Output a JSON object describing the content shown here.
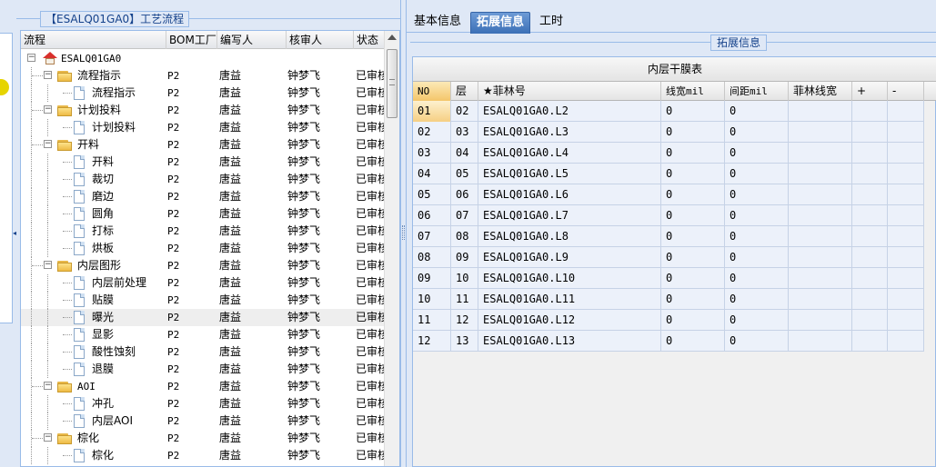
{
  "tree_panel": {
    "title": "【ESALQ01GA0】工艺流程",
    "columns": [
      "流程",
      "BOM工厂",
      "编写人",
      "核审人",
      "状态"
    ],
    "rows": [
      {
        "label": "ESALQ01GA0",
        "bom": "",
        "writer": "",
        "reviewer": "",
        "status": "",
        "kind": "root",
        "level": 0
      },
      {
        "label": "流程指示",
        "bom": "P2",
        "writer": "唐益",
        "reviewer": "钟梦飞",
        "status": "已审核",
        "kind": "folder",
        "level": 1
      },
      {
        "label": "流程指示",
        "bom": "P2",
        "writer": "唐益",
        "reviewer": "钟梦飞",
        "status": "已审核",
        "kind": "file",
        "level": 2
      },
      {
        "label": "计划投料",
        "bom": "P2",
        "writer": "唐益",
        "reviewer": "钟梦飞",
        "status": "已审核",
        "kind": "folder",
        "level": 1
      },
      {
        "label": "计划投料",
        "bom": "P2",
        "writer": "唐益",
        "reviewer": "钟梦飞",
        "status": "已审核",
        "kind": "file",
        "level": 2
      },
      {
        "label": "开料",
        "bom": "P2",
        "writer": "唐益",
        "reviewer": "钟梦飞",
        "status": "已审核",
        "kind": "folder",
        "level": 1
      },
      {
        "label": "开料",
        "bom": "P2",
        "writer": "唐益",
        "reviewer": "钟梦飞",
        "status": "已审核",
        "kind": "file",
        "level": 2
      },
      {
        "label": "裁切",
        "bom": "P2",
        "writer": "唐益",
        "reviewer": "钟梦飞",
        "status": "已审核",
        "kind": "file",
        "level": 2
      },
      {
        "label": "磨边",
        "bom": "P2",
        "writer": "唐益",
        "reviewer": "钟梦飞",
        "status": "已审核",
        "kind": "file",
        "level": 2
      },
      {
        "label": "圆角",
        "bom": "P2",
        "writer": "唐益",
        "reviewer": "钟梦飞",
        "status": "已审核",
        "kind": "file",
        "level": 2
      },
      {
        "label": "打标",
        "bom": "P2",
        "writer": "唐益",
        "reviewer": "钟梦飞",
        "status": "已审核",
        "kind": "file",
        "level": 2
      },
      {
        "label": "烘板",
        "bom": "P2",
        "writer": "唐益",
        "reviewer": "钟梦飞",
        "status": "已审核",
        "kind": "file",
        "level": 2
      },
      {
        "label": "内层图形",
        "bom": "P2",
        "writer": "唐益",
        "reviewer": "钟梦飞",
        "status": "已审核",
        "kind": "folder",
        "level": 1
      },
      {
        "label": "内层前处理",
        "bom": "P2",
        "writer": "唐益",
        "reviewer": "钟梦飞",
        "status": "已审核",
        "kind": "file",
        "level": 2
      },
      {
        "label": "贴膜",
        "bom": "P2",
        "writer": "唐益",
        "reviewer": "钟梦飞",
        "status": "已审核",
        "kind": "file",
        "level": 2
      },
      {
        "label": "曝光",
        "bom": "P2",
        "writer": "唐益",
        "reviewer": "钟梦飞",
        "status": "已审核",
        "kind": "file",
        "level": 2,
        "selected": true
      },
      {
        "label": "显影",
        "bom": "P2",
        "writer": "唐益",
        "reviewer": "钟梦飞",
        "status": "已审核",
        "kind": "file",
        "level": 2
      },
      {
        "label": "酸性蚀刻",
        "bom": "P2",
        "writer": "唐益",
        "reviewer": "钟梦飞",
        "status": "已审核",
        "kind": "file",
        "level": 2
      },
      {
        "label": "退膜",
        "bom": "P2",
        "writer": "唐益",
        "reviewer": "钟梦飞",
        "status": "已审核",
        "kind": "file",
        "level": 2
      },
      {
        "label": "AOI",
        "bom": "P2",
        "writer": "唐益",
        "reviewer": "钟梦飞",
        "status": "已审核",
        "kind": "folder",
        "level": 1
      },
      {
        "label": "冲孔",
        "bom": "P2",
        "writer": "唐益",
        "reviewer": "钟梦飞",
        "status": "已审核",
        "kind": "file",
        "level": 2
      },
      {
        "label": "内层AOI",
        "bom": "P2",
        "writer": "唐益",
        "reviewer": "钟梦飞",
        "status": "已审核",
        "kind": "file",
        "level": 2
      },
      {
        "label": "棕化",
        "bom": "P2",
        "writer": "唐益",
        "reviewer": "钟梦飞",
        "status": "已审核",
        "kind": "folder",
        "level": 1
      },
      {
        "label": "棕化",
        "bom": "P2",
        "writer": "唐益",
        "reviewer": "钟梦飞",
        "status": "已审核",
        "kind": "file",
        "level": 2
      }
    ]
  },
  "tabs": [
    "基本信息",
    "拓展信息",
    "工时"
  ],
  "active_tab": 1,
  "fieldset_title": "拓展信息",
  "grid": {
    "caption": "内层干膜表",
    "columns": [
      "NO",
      "层",
      "★菲林号",
      "线宽mil",
      "间距mil",
      "菲林线宽",
      "+",
      "-"
    ],
    "rows": [
      [
        "01",
        "02",
        "ESALQ01GA0.L2",
        "0",
        "0",
        "",
        "",
        ""
      ],
      [
        "02",
        "03",
        "ESALQ01GA0.L3",
        "0",
        "0",
        "",
        "",
        ""
      ],
      [
        "03",
        "04",
        "ESALQ01GA0.L4",
        "0",
        "0",
        "",
        "",
        ""
      ],
      [
        "04",
        "05",
        "ESALQ01GA0.L5",
        "0",
        "0",
        "",
        "",
        ""
      ],
      [
        "05",
        "06",
        "ESALQ01GA0.L6",
        "0",
        "0",
        "",
        "",
        ""
      ],
      [
        "06",
        "07",
        "ESALQ01GA0.L7",
        "0",
        "0",
        "",
        "",
        ""
      ],
      [
        "07",
        "08",
        "ESALQ01GA0.L8",
        "0",
        "0",
        "",
        "",
        ""
      ],
      [
        "08",
        "09",
        "ESALQ01GA0.L9",
        "0",
        "0",
        "",
        "",
        ""
      ],
      [
        "09",
        "10",
        "ESALQ01GA0.L10",
        "0",
        "0",
        "",
        "",
        ""
      ],
      [
        "10",
        "11",
        "ESALQ01GA0.L11",
        "0",
        "0",
        "",
        "",
        ""
      ],
      [
        "11",
        "12",
        "ESALQ01GA0.L12",
        "0",
        "0",
        "",
        "",
        ""
      ],
      [
        "12",
        "13",
        "ESALQ01GA0.L13",
        "0",
        "0",
        "",
        "",
        ""
      ]
    ]
  },
  "colors": {
    "panel_bg": "#dfe8f6",
    "border": "#99bbe8",
    "title_text": "#15428b",
    "active_tab": "#3b6fb6",
    "header_highlight": "#f4c66a"
  },
  "icons": [
    "home-icon",
    "folder-icon",
    "file-icon",
    "expand-minus-icon",
    "scroll-up-icon"
  ]
}
